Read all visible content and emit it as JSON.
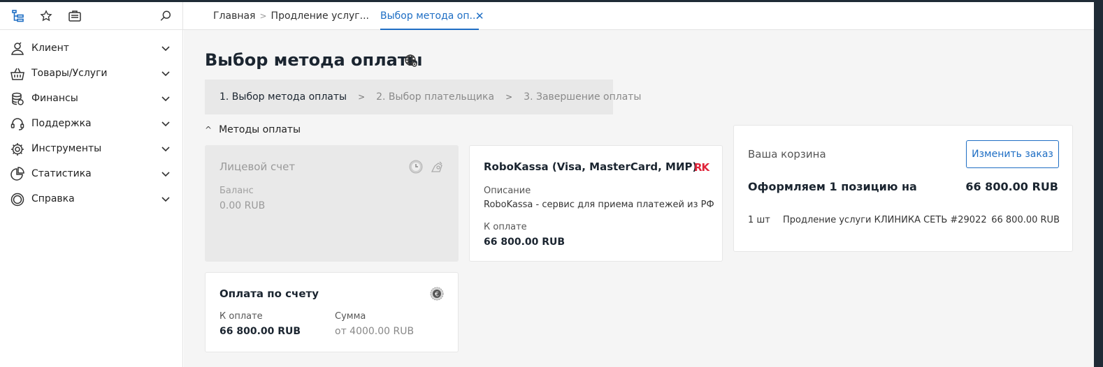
{
  "topbar": {
    "breadcrumb": [
      "Главная",
      "Продление услуг..."
    ],
    "active_tab": "Выбор метода оп...",
    "close_glyph": "✕"
  },
  "sidebar": {
    "items": [
      {
        "label": "Клиент",
        "icon": "user-icon"
      },
      {
        "label": "Товары/Услуги",
        "icon": "basket-icon"
      },
      {
        "label": "Финансы",
        "icon": "coins-icon"
      },
      {
        "label": "Поддержка",
        "icon": "headset-icon"
      },
      {
        "label": "Инструменты",
        "icon": "gear-icon"
      },
      {
        "label": "Статистика",
        "icon": "pie-chart-icon"
      },
      {
        "label": "Справка",
        "icon": "lifebuoy-icon"
      }
    ]
  },
  "page": {
    "title": "Выбор метода оплаты",
    "steps": [
      "1. Выбор метода оплаты",
      "2. Выбор плательщика",
      "3. Завершение оплаты"
    ],
    "section": "Методы оплаты"
  },
  "methods": {
    "personal": {
      "title": "Лицевой счет",
      "balance_label": "Баланс",
      "balance_value": "0.00 RUB"
    },
    "robokassa": {
      "title": "RoboKassa (Visa, MasterCard, МИР)",
      "logo_text": "RK",
      "desc_label": "Описание",
      "desc": "RoboKassa - сервис для приема платежей из РФ",
      "pay_label": "К оплате",
      "pay_value": "66 800.00 RUB"
    },
    "invoice": {
      "title": "Оплата по счету",
      "pay_label": "К оплате",
      "pay_value": "66 800.00 RUB",
      "sum_label": "Сумма",
      "sum_value": "от 4000.00 RUB"
    }
  },
  "cart": {
    "title": "Ваша корзина",
    "change_button": "Изменить заказ",
    "summary_label": "Оформляем 1 позицию на",
    "summary_value": "66 800.00 RUB",
    "item": {
      "qty": "1 шт",
      "name": "Продление услуги КЛИНИКА СЕТЬ #29022",
      "price": "66 800.00 RUB"
    }
  },
  "colors": {
    "accent": "#1e6ec4",
    "dark": "#1f2b36",
    "logo_red": "#e0253a"
  }
}
